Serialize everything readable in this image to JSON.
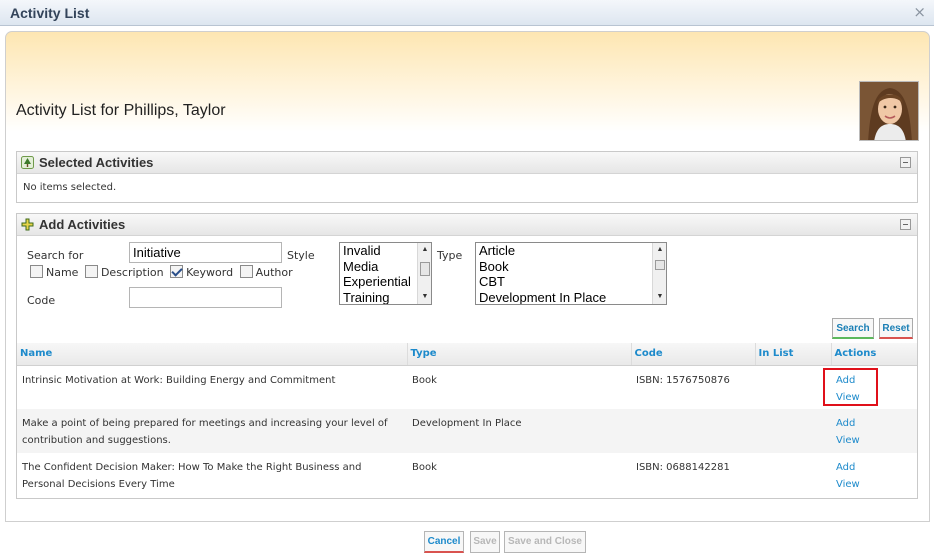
{
  "window": {
    "title": "Activity List",
    "close_glyph": "×"
  },
  "page": {
    "heading": "Activity List for Phillips, Taylor"
  },
  "selected_section": {
    "title": "Selected Activities",
    "empty_message": "No items selected."
  },
  "add_section": {
    "title": "Add Activities",
    "search_label": "Search for",
    "search_value": "Initiative",
    "filters": [
      {
        "label": "Name",
        "checked": false
      },
      {
        "label": "Description",
        "checked": false
      },
      {
        "label": "Keyword",
        "checked": true
      },
      {
        "label": "Author",
        "checked": false
      }
    ],
    "code_label": "Code",
    "code_value": "",
    "style_label": "Style",
    "style_options": [
      "Invalid",
      "Media",
      "Experiential",
      "Training"
    ],
    "type_label": "Type",
    "type_options": [
      "Article",
      "Book",
      "CBT",
      "Development In Place"
    ],
    "search_button": "Search",
    "reset_button": "Reset"
  },
  "table": {
    "columns": [
      "Name",
      "Type",
      "Code",
      "In List",
      "Actions"
    ],
    "rows": [
      {
        "name": "Intrinsic Motivation at Work: Building Energy and Commitment",
        "type": "Book",
        "code": "ISBN: 1576750876",
        "in_list": "",
        "add": "Add",
        "view": "View"
      },
      {
        "name": "Make a point of being prepared for meetings and increasing your level of contribution and suggestions.",
        "type": "Development In Place",
        "code": "",
        "in_list": "",
        "add": "Add",
        "view": "View"
      },
      {
        "name": "The Confident Decision Maker: How To Make the Right Business and Personal Decisions Every Time",
        "type": "Book",
        "code": "ISBN: 0688142281",
        "in_list": "",
        "add": "Add",
        "view": "View"
      }
    ]
  },
  "footer": {
    "cancel": "Cancel",
    "save": "Save",
    "save_close": "Save and Close"
  },
  "icons": {
    "selected": "tree-icon",
    "add": "plus-icon",
    "collapse": "minimize-icon"
  },
  "colors": {
    "link": "#1d8acb",
    "highlight": "#e0101a",
    "header_gradient_top": "#fde6b2"
  }
}
